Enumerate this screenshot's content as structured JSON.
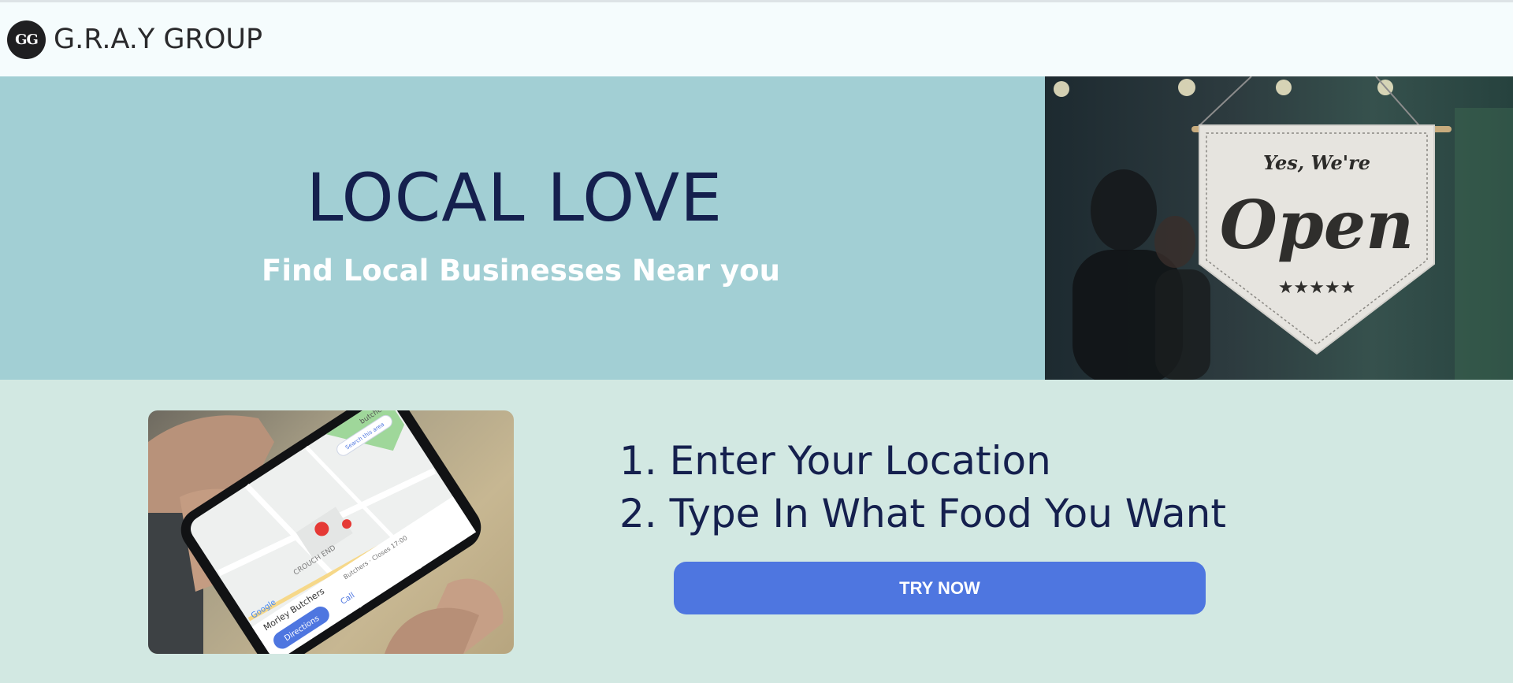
{
  "header": {
    "logo_initials": "GG",
    "brand": "G.R.A.Y GROUP"
  },
  "hero": {
    "title": "LOCAL LOVE",
    "subtitle": "Find Local Businesses Near you",
    "sign": {
      "line1": "Yes, We're",
      "line2": "Open",
      "stars": "★★★★★"
    }
  },
  "map_photo": {
    "search_text": "butcher",
    "search_area": "Search this area",
    "place": "Morley Butchers",
    "place_meta": "Butchers · Closes 17:00",
    "area_label": "CROUCH END",
    "directions": "Directions",
    "call": "Call",
    "map_brand": "Google"
  },
  "steps": {
    "step1": "1. Enter Your Location",
    "step2": "2. Type In What Food You Want"
  },
  "cta": {
    "label": "TRY NOW"
  },
  "colors": {
    "hero_bg": "#a2cfd4",
    "page_bg": "#d2e8e2",
    "title": "#15204e",
    "cta": "#4e76e0"
  }
}
